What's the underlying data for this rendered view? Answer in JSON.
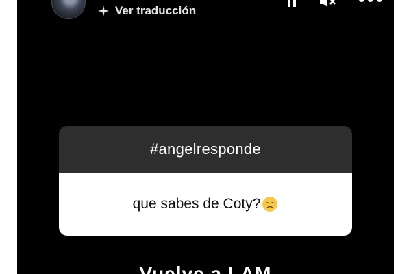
{
  "header": {
    "avatar_icon": "profile-avatar",
    "translate_label": "Ver traducción",
    "translate_icon": "sparkle-icon",
    "controls": {
      "pause_icon": "pause-icon",
      "mute_icon": "speaker-muted-icon",
      "more_icon": "more-dots-icon"
    }
  },
  "question_box": {
    "header": "#angelresponde",
    "question": "que sabes de Coty?",
    "emoji_icon": "disappointed-face-emoji"
  },
  "caption": {
    "text": "Vuelve a LAM"
  },
  "colors": {
    "background": "#000000",
    "question_header_bg": "#2e2e2e",
    "question_body_bg": "#ffffff",
    "emoji_yellow": "#f6c84c"
  }
}
